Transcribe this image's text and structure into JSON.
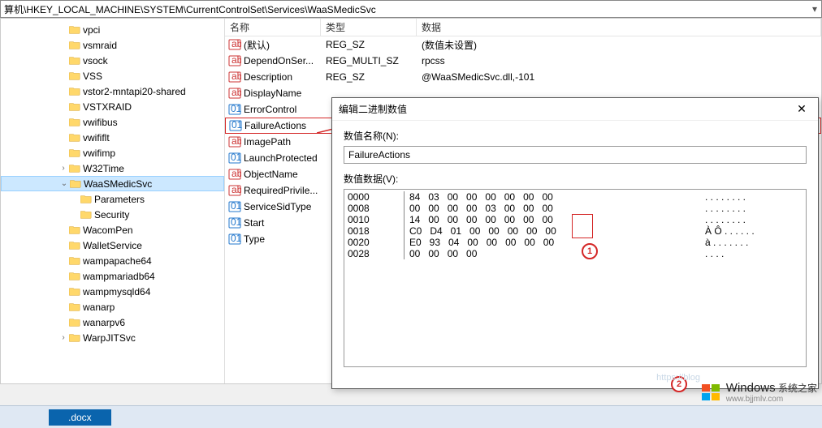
{
  "address": "算机\\HKEY_LOCAL_MACHINE\\SYSTEM\\CurrentControlSet\\Services\\WaaSMedicSvc",
  "tree": {
    "items": [
      {
        "label": "vpci",
        "indent": 5,
        "tw": ""
      },
      {
        "label": "vsmraid",
        "indent": 5,
        "tw": ""
      },
      {
        "label": "vsock",
        "indent": 5,
        "tw": ""
      },
      {
        "label": "VSS",
        "indent": 5,
        "tw": ""
      },
      {
        "label": "vstor2-mntapi20-shared",
        "indent": 5,
        "tw": ""
      },
      {
        "label": "VSTXRAID",
        "indent": 5,
        "tw": ""
      },
      {
        "label": "vwifibus",
        "indent": 5,
        "tw": ""
      },
      {
        "label": "vwififlt",
        "indent": 5,
        "tw": ""
      },
      {
        "label": "vwifimp",
        "indent": 5,
        "tw": ""
      },
      {
        "label": "W32Time",
        "indent": 5,
        "tw": ">"
      },
      {
        "label": "WaaSMedicSvc",
        "indent": 5,
        "tw": "v",
        "selected": true
      },
      {
        "label": "Parameters",
        "indent": 6,
        "tw": ""
      },
      {
        "label": "Security",
        "indent": 6,
        "tw": ""
      },
      {
        "label": "WacomPen",
        "indent": 5,
        "tw": ""
      },
      {
        "label": "WalletService",
        "indent": 5,
        "tw": ""
      },
      {
        "label": "wampapache64",
        "indent": 5,
        "tw": ""
      },
      {
        "label": "wampmariadb64",
        "indent": 5,
        "tw": ""
      },
      {
        "label": "wampmysqld64",
        "indent": 5,
        "tw": ""
      },
      {
        "label": "wanarp",
        "indent": 5,
        "tw": ""
      },
      {
        "label": "wanarpv6",
        "indent": 5,
        "tw": ""
      },
      {
        "label": "WarpJITSvc",
        "indent": 5,
        "tw": ">"
      }
    ]
  },
  "list": {
    "headers": {
      "name": "名称",
      "type": "类型",
      "data": "数据"
    },
    "rows": [
      {
        "icon": "sz",
        "name": "(默认)",
        "type": "REG_SZ",
        "data": "(数值未设置)"
      },
      {
        "icon": "sz",
        "name": "DependOnSer...",
        "type": "REG_MULTI_SZ",
        "data": "rpcss"
      },
      {
        "icon": "sz",
        "name": "Description",
        "type": "REG_SZ",
        "data": "@WaaSMedicSvc.dll,-101"
      },
      {
        "icon": "sz",
        "name": "DisplayName",
        "type": "",
        "data": ""
      },
      {
        "icon": "bin",
        "name": "ErrorControl",
        "type": "",
        "data": ""
      },
      {
        "icon": "bin",
        "name": "FailureActions",
        "type": "",
        "data": "",
        "highlight": true
      },
      {
        "icon": "sz",
        "name": "ImagePath",
        "type": "",
        "data": ""
      },
      {
        "icon": "bin",
        "name": "LaunchProtected",
        "type": "",
        "data": ""
      },
      {
        "icon": "sz",
        "name": "ObjectName",
        "type": "",
        "data": ""
      },
      {
        "icon": "sz",
        "name": "RequiredPrivile...",
        "type": "",
        "data": ""
      },
      {
        "icon": "bin",
        "name": "ServiceSidType",
        "type": "",
        "data": ""
      },
      {
        "icon": "bin",
        "name": "Start",
        "type": "",
        "data": ""
      },
      {
        "icon": "bin",
        "name": "Type",
        "type": "",
        "data": ""
      }
    ]
  },
  "dialog": {
    "title": "编辑二进制数值",
    "name_label": "数值名称(N):",
    "name_value": "FailureActions",
    "data_label": "数值数据(V):",
    "hex": [
      {
        "off": "0000",
        "b": "84   03   00   00   00   00   00   00",
        "a": ". . . . . . . ."
      },
      {
        "off": "0008",
        "b": "00   00   00   00   03   00   00   00",
        "a": ". . . . . . . ."
      },
      {
        "off": "0010",
        "b": "14   00   00   00   00   00   00   00",
        "a": ". . . . . . . ."
      },
      {
        "off": "0018",
        "b": "C0   D4   01   00   00   00   00   00",
        "a": "À Ô . . . . . ."
      },
      {
        "off": "0020",
        "b": "E0   93   04   00   00   00   00   00",
        "a": "à . . . . . . ."
      },
      {
        "off": "0028",
        "b": "00   00   00   00",
        "a": ". . . ."
      }
    ]
  },
  "annotations": {
    "a1": "1",
    "a2": "2"
  },
  "taskbar": {
    "doc": ".docx"
  },
  "watermark": {
    "brand": "Windows",
    "sub1": "系统之家",
    "sub2": "www.bjjmlv.com"
  }
}
